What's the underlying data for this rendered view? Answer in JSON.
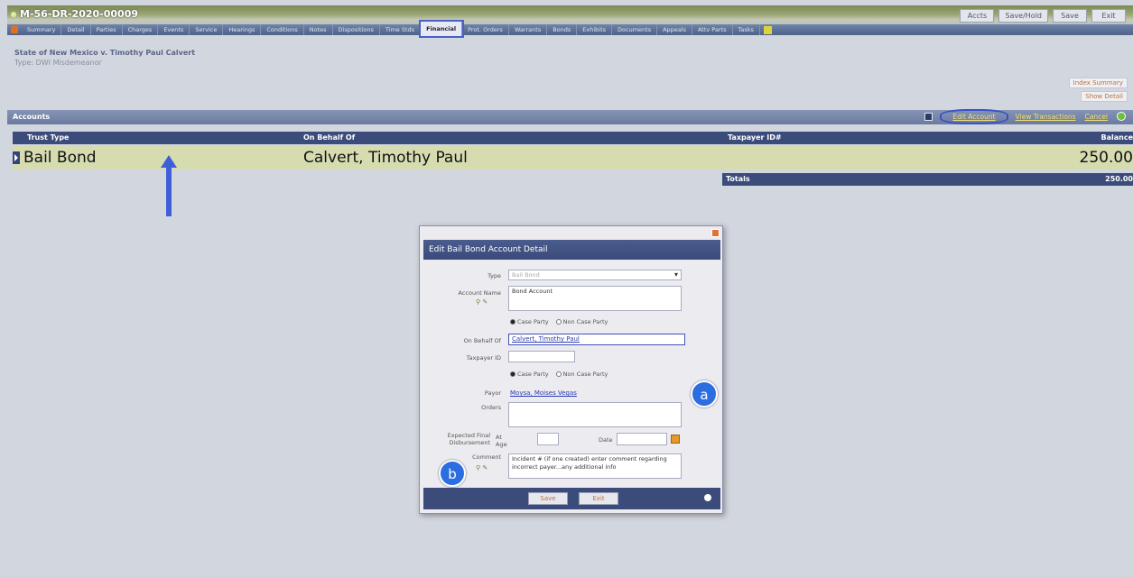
{
  "window": {
    "case_id": "M-56-DR-2020-00009"
  },
  "top_buttons": [
    "Accts",
    "Save/Hold",
    "Save",
    "Exit"
  ],
  "tabs": [
    "Summary",
    "Detail",
    "Parties",
    "Charges",
    "Events",
    "Service",
    "Hearings",
    "Conditions",
    "Notes",
    "Dispositions",
    "Time Stds",
    "Financial",
    "Prot. Orders",
    "Warrants",
    "Bonds",
    "Exhibits",
    "Documents",
    "Appeals",
    "Attv Parts",
    "Tasks"
  ],
  "active_tab": "Financial",
  "case": {
    "title": "State of New Mexico v. Timothy Paul Calvert",
    "type": "Type: DWI Misdemeanor"
  },
  "side_links": [
    "Index Summary",
    "Show Detail"
  ],
  "accounts": {
    "title": "Accounts",
    "actions": [
      "Edit Account",
      "View Transactions",
      "Cancel"
    ],
    "columns": [
      "Trust Type",
      "On Behalf Of",
      "Taxpayer ID#",
      "Balance"
    ],
    "rows": [
      {
        "trust_type": "Bail Bond",
        "on_behalf_of": "Calvert, Timothy Paul",
        "taxpayer_id": "",
        "balance": "250.00"
      }
    ],
    "totals_label": "Totals",
    "totals_value": "250.00"
  },
  "dialog": {
    "title": "Edit Bail Bond Account Detail",
    "type_label": "Type",
    "type_value": "Bail Bond",
    "account_name_label": "Account Name",
    "account_name_value": "Bond Account",
    "radio_case_party": "Case Party",
    "radio_non_case_party": "Non Case Party",
    "on_behalf_label": "On Behalf Of",
    "on_behalf_value": "Calvert, Timothy Paul",
    "taxpayer_label": "Taxpayer ID",
    "taxpayer_value": "",
    "payor_label": "Payor",
    "payor_value": "Moysa, Moises Vegas",
    "orders_label": "Orders",
    "orders_value": "",
    "disbursement_label": "Expected Final Disbursement",
    "at_age_label": "At Age",
    "date_label": "Date",
    "comment_label": "Comment",
    "comment_value": "Incident # (if one created) enter comment regarding incorrect payer...any additional info",
    "save_label": "Save",
    "exit_label": "Exit"
  },
  "annotations": {
    "badge_a": "a",
    "badge_b": "b"
  },
  "colors": {
    "tab_active_outline": "#4a5fc8",
    "row_highlight": "#d6dcb0",
    "header_dark": "#3c4c7a",
    "badge": "#2c6ee0",
    "arrow": "#3f5fd8"
  }
}
